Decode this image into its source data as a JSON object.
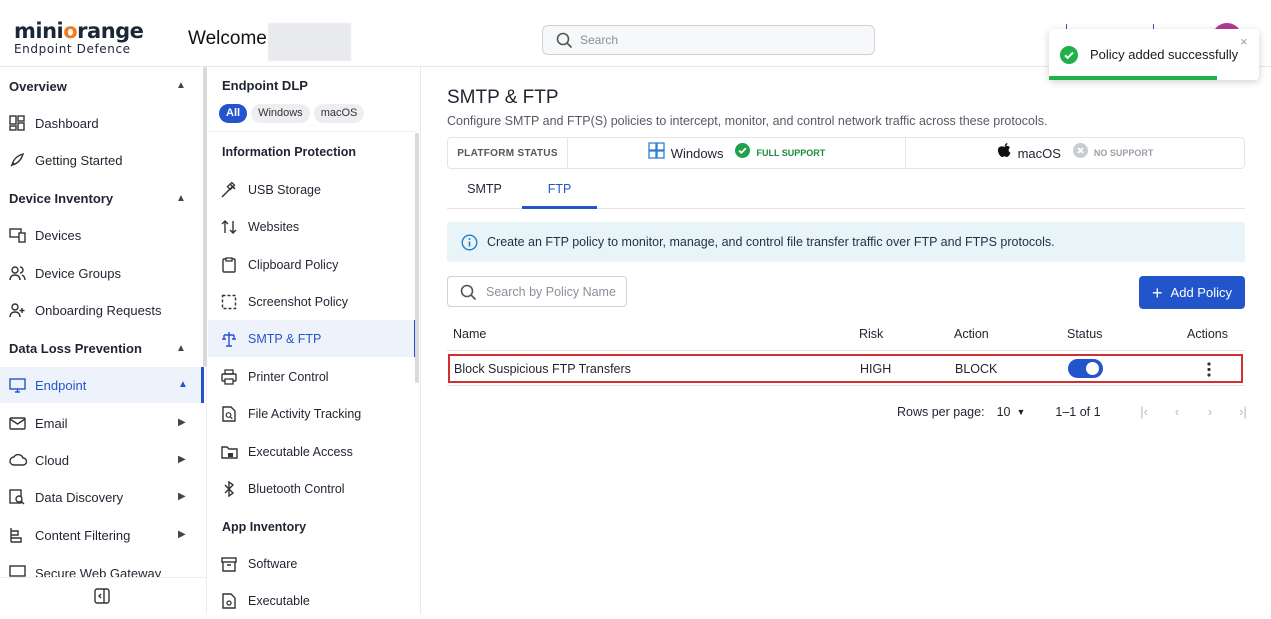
{
  "header": {
    "logo_main_a": "mini",
    "logo_main_o": "o",
    "logo_main_b": "range",
    "logo_sub": "Endpoint Defence",
    "welcome": "Welcome,",
    "search_placeholder": "Search"
  },
  "toast": {
    "message": "Policy added successfully",
    "close": "×",
    "progress": 0.8
  },
  "sidebar": {
    "sections": [
      {
        "label": "Overview",
        "items": [
          {
            "label": "Dashboard",
            "icon": "dashboard-icon"
          },
          {
            "label": "Getting Started",
            "icon": "rocket-icon"
          }
        ]
      },
      {
        "label": "Device Inventory",
        "items": [
          {
            "label": "Devices",
            "icon": "devices-icon"
          },
          {
            "label": "Device Groups",
            "icon": "users-icon"
          },
          {
            "label": "Onboarding Requests",
            "icon": "user-add-icon"
          }
        ]
      },
      {
        "label": "Data Loss Prevention",
        "items": [
          {
            "label": "Endpoint",
            "icon": "monitor-icon"
          },
          {
            "label": "Email",
            "icon": "mail-icon"
          },
          {
            "label": "Cloud",
            "icon": "cloud-icon"
          },
          {
            "label": "Data Discovery",
            "icon": "discovery-icon"
          },
          {
            "label": "Content Filtering",
            "icon": "filter-icon"
          },
          {
            "label": "Secure Web Gateway",
            "icon": "gateway-icon"
          }
        ]
      }
    ]
  },
  "subnav": {
    "title": "Endpoint DLP",
    "chips": [
      "All",
      "Windows",
      "macOS"
    ],
    "group1": "Information Protection",
    "items1": [
      "USB Storage",
      "Websites",
      "Clipboard Policy",
      "Screenshot Policy",
      "SMTP & FTP",
      "Printer Control",
      "File Activity Tracking",
      "Executable Access",
      "Bluetooth Control"
    ],
    "group2": "App Inventory",
    "items2": [
      "Software",
      "Executable"
    ]
  },
  "main": {
    "title": "SMTP & FTP",
    "description": "Configure SMTP and FTP(S) policies to intercept, monitor, and control network traffic across these protocols.",
    "platform": {
      "label": "PLATFORM STATUS",
      "windows": "Windows",
      "windows_status": "FULL SUPPORT",
      "mac": "macOS",
      "mac_status": "NO SUPPORT"
    },
    "tabs": [
      "SMTP",
      "FTP"
    ],
    "info": "Create an FTP policy to monitor, manage, and control file transfer traffic over FTP and FTPS protocols.",
    "search_placeholder": "Search by Policy Name",
    "add_label": "Add Policy",
    "columns": {
      "name": "Name",
      "risk": "Risk",
      "action": "Action",
      "status": "Status",
      "actions": "Actions"
    },
    "row": {
      "name": "Block Suspicious FTP Transfers",
      "risk": "HIGH",
      "action": "BLOCK",
      "status_on": true
    },
    "pager": {
      "label": "Rows per page:",
      "value": "10",
      "range": "1–1 of 1"
    }
  },
  "colors": {
    "accent": "#2255cc",
    "success": "#22b04b",
    "highlight": "#d32f2f"
  }
}
